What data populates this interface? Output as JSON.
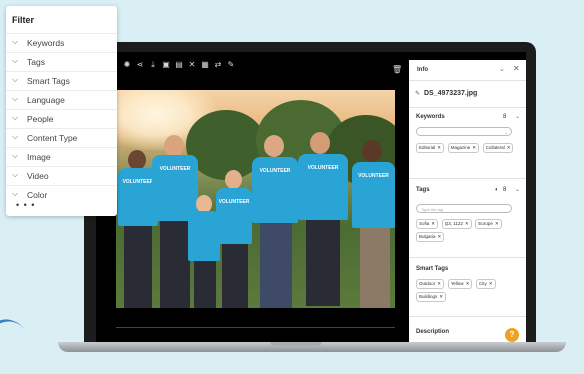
{
  "filter": {
    "title": "Filter",
    "items": [
      "Keywords",
      "Tags",
      "Smart Tags",
      "Language",
      "People",
      "Content Type",
      "Image",
      "Video",
      "Color"
    ],
    "more": "• • •"
  },
  "toolbar": {
    "icons": [
      "settings-icon",
      "share-icon",
      "download-icon",
      "delete-icon",
      "comment-icon",
      "crop-icon",
      "image-icon",
      "swap-icon",
      "edit-icon"
    ],
    "trash_icon": "trash-icon"
  },
  "photo": {
    "shirt_text": "VOLUNTEER"
  },
  "info": {
    "title": "Info",
    "filename": "DS_4973237.jpg",
    "keywords": {
      "title": "Keywords",
      "count": "8",
      "chips": [
        "Editorial",
        "Magazine",
        "Collateral"
      ]
    },
    "tags": {
      "title": "Tags",
      "count": "8",
      "placeholder": "Type the tag",
      "chips": [
        "Sofia",
        "Q3, 1122",
        "Europe",
        "Bulgaria"
      ]
    },
    "smart_tags": {
      "title": "Smart Tags",
      "chips": [
        "Outdoor",
        "Yellow",
        "City",
        "Buildings"
      ]
    },
    "description": {
      "title": "Description",
      "help": "?"
    }
  },
  "colors": {
    "background": "#d9eff4",
    "shirt": "#2aa4d4",
    "accent": "#f0a023"
  }
}
